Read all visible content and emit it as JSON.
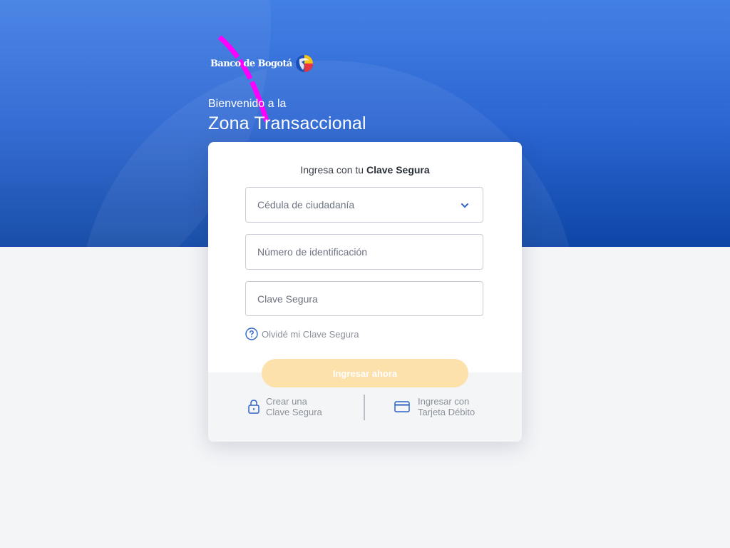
{
  "header": {
    "brand_name": "Banco de Bogotá",
    "welcome_line": "Bienvenido a la",
    "title": "Zona Transaccional"
  },
  "login_card": {
    "title_prefix": "Ingresa con tu ",
    "title_emphasis": "Clave Segura",
    "document_type": {
      "selected_value": "Cédula de ciudadanía",
      "icon": "chevron-down-icon"
    },
    "id_number": {
      "placeholder": "Número de identificación"
    },
    "password": {
      "placeholder": "Clave Segura"
    },
    "forgot_link": "Olvidé mi Clave Segura",
    "submit_label": "Ingresar ahora"
  },
  "footer_options": [
    {
      "icon": "lock-icon",
      "line1": "Crear una",
      "line2": "Clave Segura"
    },
    {
      "icon": "credit-card-icon",
      "line1": "Ingresar con",
      "line2": "Tarjeta Débito"
    }
  ],
  "colors": {
    "hero_top": "#4380e4",
    "hero_bottom": "#0d46a5",
    "button_disabled": "#fde1ab",
    "accent_blue": "#2f64c8",
    "annotation_stroke": "#ff00ff"
  }
}
